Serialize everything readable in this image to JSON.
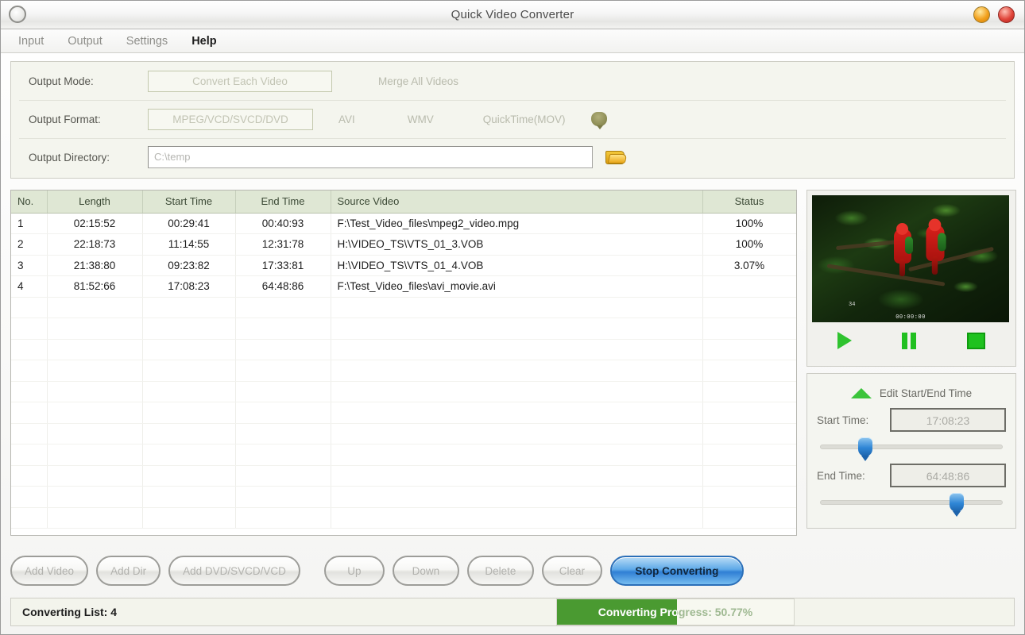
{
  "window": {
    "title": "Quick Video Converter",
    "app_icon": "app-circle-icon",
    "minimize_icon": "minimize-icon",
    "close_icon": "close-icon"
  },
  "menubar": {
    "items": [
      {
        "label": "Input",
        "active": false
      },
      {
        "label": "Output",
        "active": false
      },
      {
        "label": "Settings",
        "active": false
      },
      {
        "label": "Help",
        "active": true
      }
    ]
  },
  "options": {
    "output_mode": {
      "label": "Output Mode:",
      "options": [
        "Convert Each Video",
        "Merge All Videos"
      ],
      "selected": "Convert Each Video"
    },
    "output_format": {
      "label": "Output Format:",
      "options": [
        "MPEG/VCD/SVCD/DVD",
        "AVI",
        "WMV",
        "QuickTime(MOV)"
      ],
      "selected": "MPEG/VCD/SVCD/DVD",
      "settings_icon": "format-settings-icon"
    },
    "output_directory": {
      "label": "Output Directory:",
      "value": "C:\\temp",
      "browse_icon": "folder-browse-icon"
    }
  },
  "list": {
    "columns": [
      "No.",
      "Length",
      "Start Time",
      "End Time",
      "Source Video",
      "Status"
    ],
    "rows": [
      {
        "no": "1",
        "length": "02:15:52",
        "start": "00:29:41",
        "end": "00:40:93",
        "source": "F:\\Test_Video_files\\mpeg2_video.mpg",
        "status": "100%"
      },
      {
        "no": "2",
        "length": "22:18:73",
        "start": "11:14:55",
        "end": "12:31:78",
        "source": "H:\\VIDEO_TS\\VTS_01_3.VOB",
        "status": "100%"
      },
      {
        "no": "3",
        "length": "21:38:80",
        "start": "09:23:82",
        "end": "17:33:81",
        "source": "H:\\VIDEO_TS\\VTS_01_4.VOB",
        "status": "3.07%"
      },
      {
        "no": "4",
        "length": "81:52:66",
        "start": "17:08:23",
        "end": "64:48:86",
        "source": "F:\\Test_Video_files\\avi_movie.avi",
        "status": ""
      }
    ],
    "empty_row_count": 11
  },
  "preview": {
    "overlay_number": "34",
    "timestamp": "00:00:00",
    "play_icon": "play-icon",
    "pause_icon": "pause-icon",
    "stop_icon": "stop-icon"
  },
  "edit_panel": {
    "header": "Edit Start/End Time",
    "header_icon": "triangle-up-icon",
    "start_time": {
      "label": "Start Time:",
      "value": "17:08:23",
      "slider_percent": 22
    },
    "end_time": {
      "label": "End Time:",
      "value": "64:48:86",
      "slider_percent": 70
    }
  },
  "buttons": [
    {
      "label": "Add Video",
      "name": "add-video-button",
      "primary": false
    },
    {
      "label": "Add Dir",
      "name": "add-dir-button",
      "primary": false
    },
    {
      "label": "Add DVD/SVCD/VCD",
      "name": "add-dvd-button",
      "primary": false
    },
    {
      "label": "Up",
      "name": "move-up-button",
      "primary": false,
      "gap": true
    },
    {
      "label": "Down",
      "name": "move-down-button",
      "primary": false
    },
    {
      "label": "Delete",
      "name": "delete-button",
      "primary": false
    },
    {
      "label": "Clear",
      "name": "clear-button",
      "primary": false
    },
    {
      "label": "Stop Converting",
      "name": "stop-converting-button",
      "primary": true
    }
  ],
  "statusbar": {
    "converting_list_label": "Converting List: 4",
    "progress_text": "Converting Progress: 50.77%",
    "progress_percent": 50.77
  },
  "colors": {
    "accent_blue": "#2f7fd4",
    "progress_green": "#4a9a31",
    "header_green": "#dfe7d4",
    "transport_green": "#20c020"
  }
}
